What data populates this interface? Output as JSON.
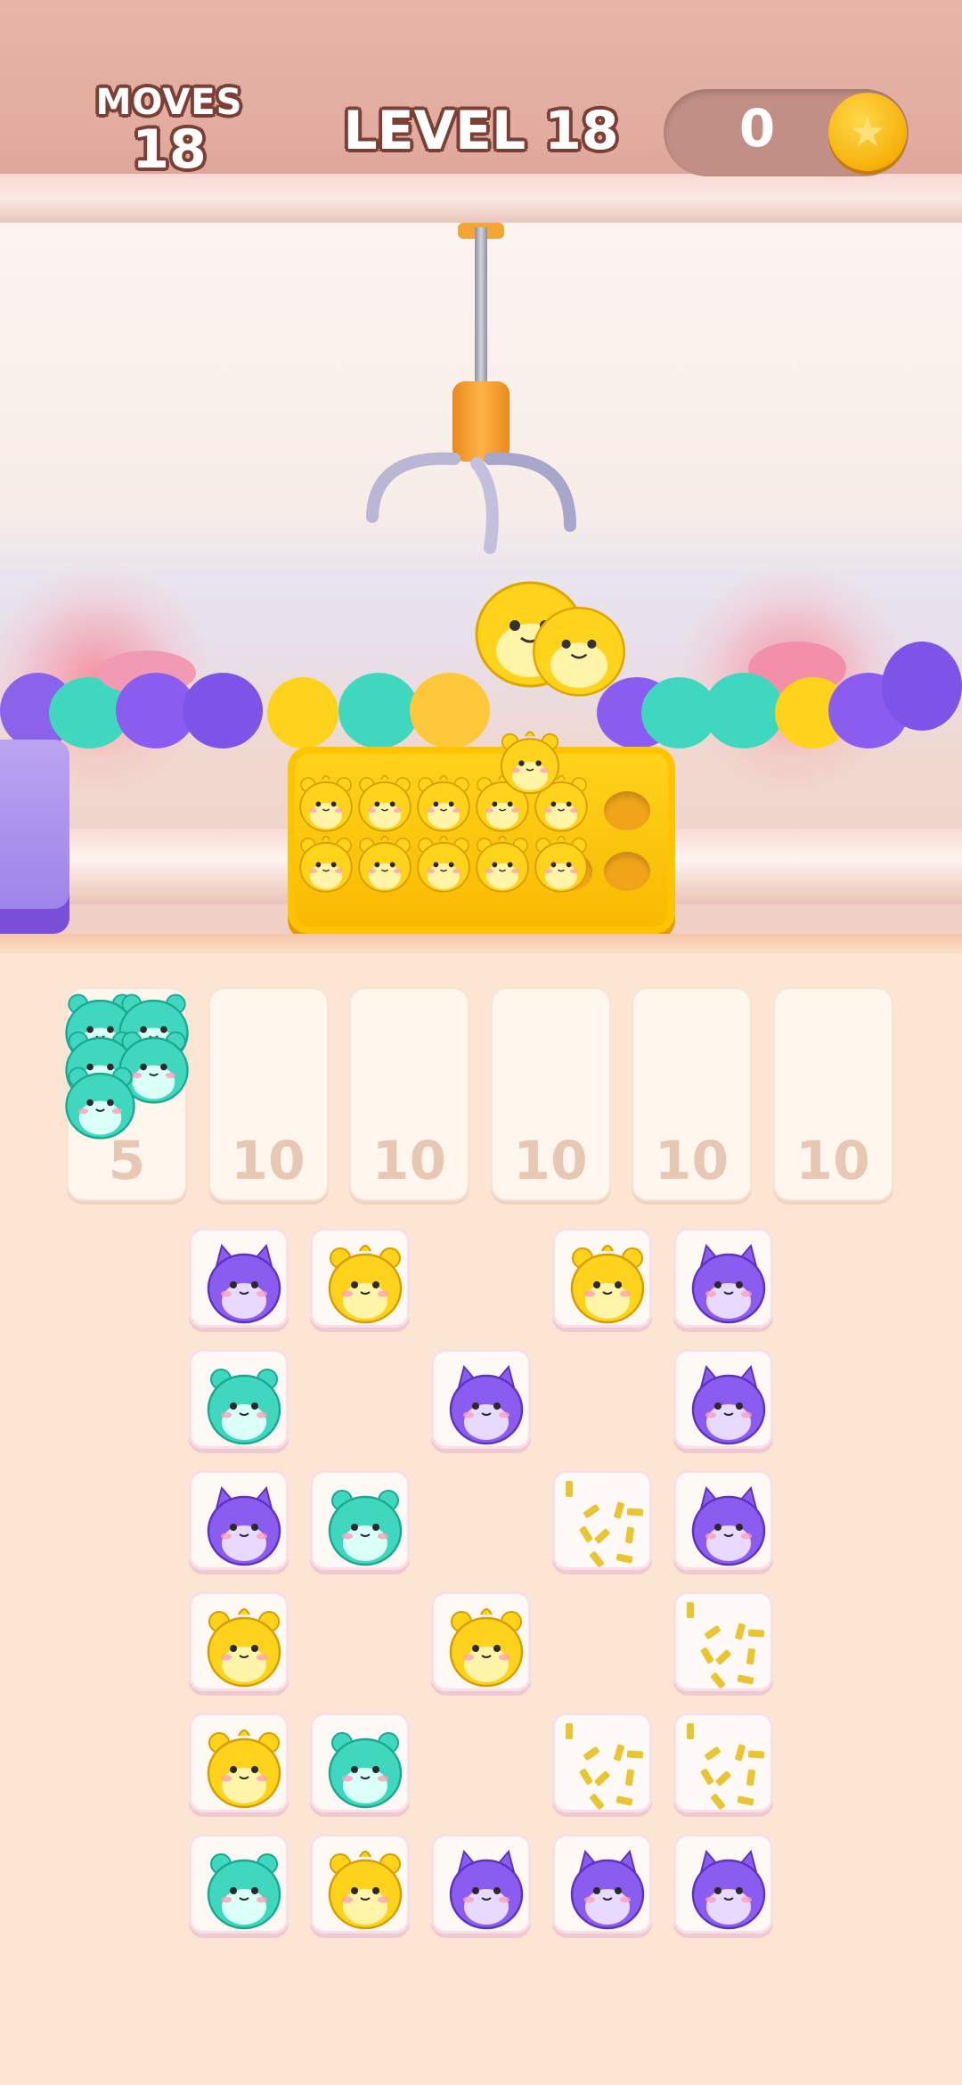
{
  "hud": {
    "moves_label": "MOVES",
    "moves_value": "18",
    "level_title": "LEVEL 18",
    "coins": "0",
    "coin_icon": "star-coin-icon"
  },
  "slots": [
    {
      "count": "5",
      "filled": "teal"
    },
    {
      "count": "10",
      "filled": ""
    },
    {
      "count": "10",
      "filled": ""
    },
    {
      "count": "10",
      "filled": ""
    },
    {
      "count": "10",
      "filled": ""
    },
    {
      "count": "10",
      "filled": ""
    }
  ],
  "colors": {
    "purple": "#8b5cf0",
    "yellow": "#ffd31c",
    "teal": "#3fd8bf",
    "coin": "#f6b10a"
  },
  "grid": [
    [
      "purple",
      "yellow",
      "",
      "yellow",
      "purple"
    ],
    [
      "teal",
      "",
      "purple",
      "",
      "purple"
    ],
    [
      "purple",
      "teal",
      "",
      "burst",
      "purple"
    ],
    [
      "yellow",
      "",
      "yellow",
      "",
      "burst"
    ],
    [
      "yellow",
      "teal",
      "",
      "burst",
      "burst"
    ],
    [
      "teal",
      "yellow",
      "purple",
      "purple",
      "purple"
    ]
  ]
}
